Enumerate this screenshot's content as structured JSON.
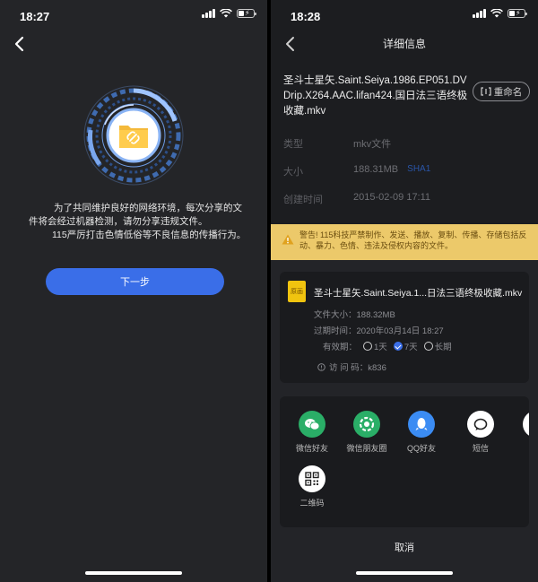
{
  "left": {
    "status_time": "18:27",
    "notice_lines": [
      "为了共同维护良好的网络环境，每次分享的文",
      "件将会经过机器检测，请勿分享违规文件。",
      "115严厉打击色情低俗等不良信息的传播行为。"
    ],
    "next_button": "下一步"
  },
  "right": {
    "status_time": "18:28",
    "nav_title": "详细信息",
    "file_title": "圣斗士星矢.Saint.Seiya.1986.EP051.DVDrip.X264.AAC.lifan424.国日法三语终极收藏.mkv",
    "rename_button": "重命名",
    "info": {
      "type_label": "类型",
      "type_value": "mkv文件",
      "size_label": "大小",
      "size_value": "188.31MB",
      "sha_link": "SHA1",
      "created_label": "创建时间",
      "created_value": "2015-02-09 17:11"
    },
    "warning_text": "警告! 115科技严禁制作、发送、播放、复制、传播、存储包括反动、暴力、色情、违法及侵权内容的文件。",
    "share_card": {
      "file_badge": "原画",
      "file_name": "圣斗士星矢.Saint.Seiya.1...日法三语终极收藏.mkv",
      "size_text": "文件大小：188.32MB",
      "expire_text": "过期时间：2020年03月14日 18:27",
      "validity_label": "有效期：",
      "options": [
        "1天",
        "7天",
        "长期"
      ],
      "selected_option": "7天",
      "access_code": "访 问 码：k836"
    },
    "share_targets": [
      {
        "label": "微信好友",
        "color": "#2aae67"
      },
      {
        "label": "微信朋友圈",
        "color": "#2aae67"
      },
      {
        "label": "QQ好友",
        "color": "#3b8cf3"
      },
      {
        "label": "短信",
        "color": "#ffffff"
      },
      {
        "label": "复",
        "color": "#ffffff"
      },
      {
        "label": "二维码",
        "color": "#ffffff"
      }
    ],
    "cancel_button": "取消"
  }
}
